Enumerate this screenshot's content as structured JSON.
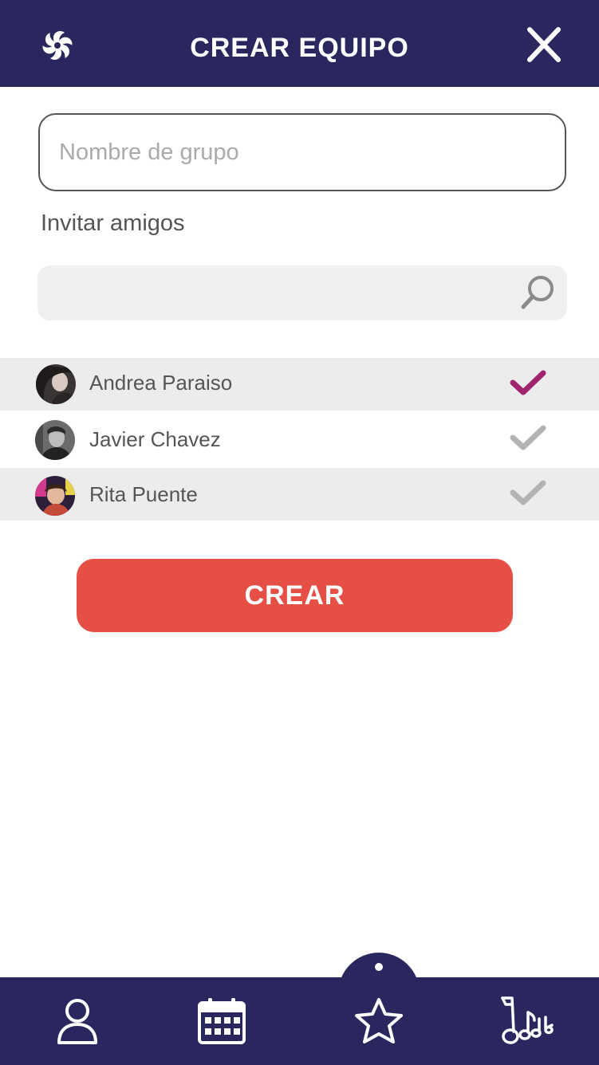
{
  "header": {
    "title": "CREAR EQUIPO",
    "logo_icon": "pinwheel-logo",
    "close_icon": "close-icon"
  },
  "form": {
    "group_name_placeholder": "Nombre de grupo",
    "group_name_value": "",
    "invite_label": "Invitar amigos",
    "search_placeholder": "",
    "search_value": ""
  },
  "friends": [
    {
      "name": "Andrea Paraiso",
      "selected": true
    },
    {
      "name": "Javier Chavez",
      "selected": false
    },
    {
      "name": "Rita Puente",
      "selected": false
    }
  ],
  "actions": {
    "create_label": "CREAR"
  },
  "colors": {
    "brand_navy": "#29275e",
    "accent_red": "#e64f45",
    "check_selected": "#a0246e",
    "check_unselected": "#b3b3b3"
  },
  "bottom_nav": {
    "items": [
      "profile-icon",
      "calendar-icon",
      "star-icon",
      "music-notes-icon"
    ],
    "active_index": 2
  }
}
